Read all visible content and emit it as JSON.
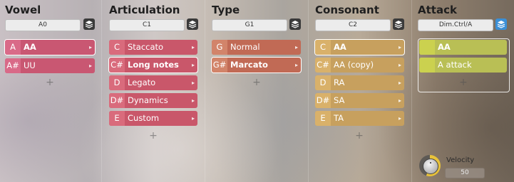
{
  "colors": {
    "vowel": "#c95772",
    "vowel_note": "#d96a88",
    "articulation": "#c9576a",
    "articulation_note": "#d96b7c",
    "type": "#c16a55",
    "type_note": "#d2846a",
    "consonant": "#c7a05e",
    "consonant_note": "#d9b16a",
    "attack": "#b9bf55",
    "attack_note": "#cbd14f",
    "accent_blue": "#3b8fd6"
  },
  "vowel": {
    "title": "Vowel",
    "selector": "A0",
    "layers_icon": "layers-icon",
    "items": [
      {
        "note": "A",
        "label": "AA"
      },
      {
        "note": "A#",
        "label": "UU"
      }
    ],
    "add": "+"
  },
  "articulation": {
    "title": "Articulation",
    "selector": "C1",
    "layers_icon": "layers-icon",
    "items": [
      {
        "note": "C",
        "label": "Staccato"
      },
      {
        "note": "C#",
        "label": "Long notes"
      },
      {
        "note": "D",
        "label": "Legato"
      },
      {
        "note": "D#",
        "label": "Dynamics"
      },
      {
        "note": "E",
        "label": "Custom"
      }
    ],
    "add": "+"
  },
  "type": {
    "title": "Type",
    "selector": "G1",
    "layers_icon": "layers-icon",
    "items": [
      {
        "note": "G",
        "label": "Normal"
      },
      {
        "note": "G#",
        "label": "Marcato"
      }
    ],
    "add": "+"
  },
  "consonant": {
    "title": "Consonant",
    "selector": "C2",
    "layers_icon": "layers-icon",
    "items": [
      {
        "note": "C",
        "label": "AA"
      },
      {
        "note": "C#",
        "label": "AA (copy)"
      },
      {
        "note": "D",
        "label": "RA"
      },
      {
        "note": "D#",
        "label": "SA"
      },
      {
        "note": "E",
        "label": "TA"
      }
    ],
    "add": "+"
  },
  "attack": {
    "title": "Attack",
    "selector": "Dim.Ctrl/A",
    "layers_icon": "layers-icon",
    "items": [
      {
        "label": "AA"
      },
      {
        "label": "A attack"
      }
    ],
    "add": "+",
    "velocity_label": "Velocity",
    "velocity_value": "50",
    "knob_icon": "knob-icon"
  },
  "item_arrow": "▸"
}
